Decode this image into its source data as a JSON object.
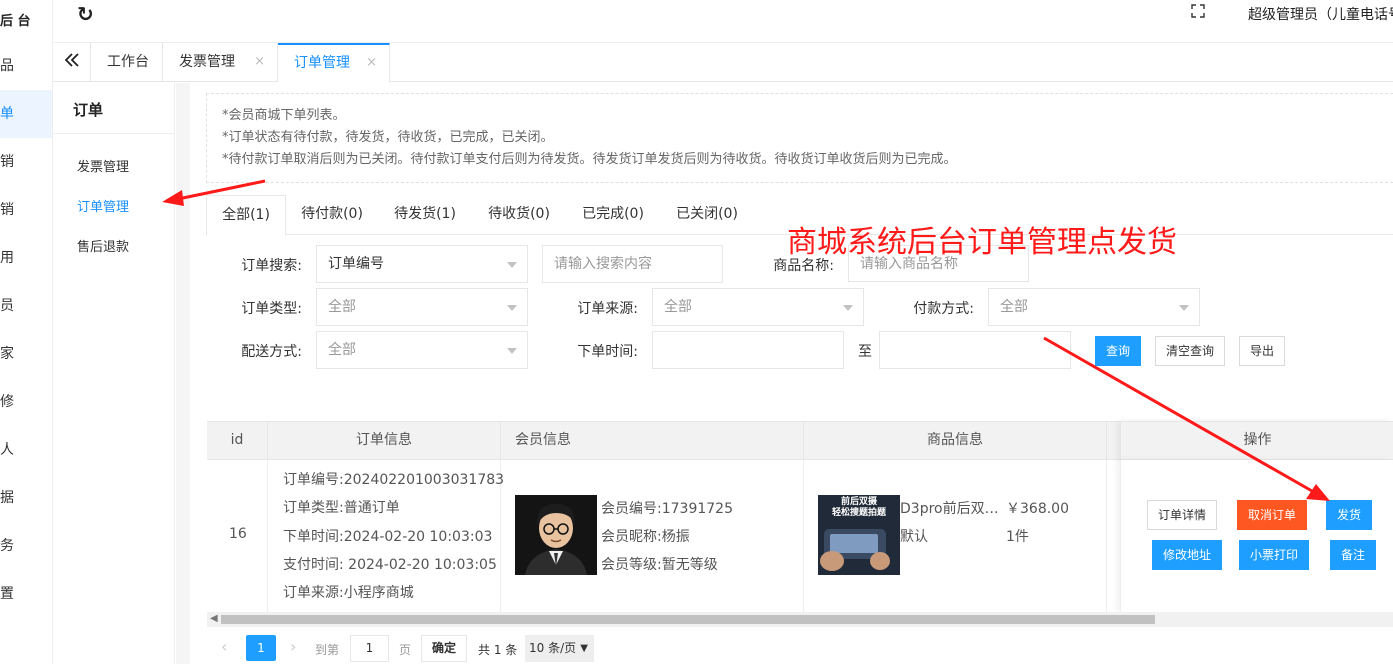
{
  "sidebar": {
    "logo": "后 台",
    "items": [
      "品",
      "单",
      "销",
      "销",
      "用",
      "员",
      "家",
      "修",
      "人",
      "据",
      "务",
      "置"
    ],
    "active_index": 1
  },
  "topbar": {
    "refresh_icon": "refresh-icon",
    "fullscreen_icon": "fullscreen-icon",
    "admin": "超级管理员（儿童电话号"
  },
  "tabs": {
    "collapse_icon": "double-chevron-left-icon",
    "items": [
      {
        "label": "工作台",
        "closable": false
      },
      {
        "label": "发票管理",
        "closable": true
      },
      {
        "label": "订单管理",
        "closable": true,
        "active": true
      }
    ],
    "close_glyph": "×"
  },
  "subnav": {
    "title": "订单",
    "items": [
      {
        "label": "发票管理"
      },
      {
        "label": "订单管理",
        "active": true
      },
      {
        "label": "售后退款"
      }
    ]
  },
  "notice": [
    "*会员商城下单列表。",
    "*订单状态有待付款，待发货，待收货，已完成，已关闭。",
    "*待付款订单取消后则为已关闭。待付款订单支付后则为待发货。待发货订单发货后则为待收货。待收货订单收货后则为已完成。"
  ],
  "status_tabs": [
    "全部(1)",
    "待付款(0)",
    "待发货(1)",
    "待收货(0)",
    "已完成(0)",
    "已关闭(0)"
  ],
  "filters": {
    "order_search_label": "订单搜索:",
    "order_search_type": "订单编号",
    "search_placeholder": "请输入搜索内容",
    "product_name_label": "商品名称:",
    "product_name_placeholder": "请输入商品名称",
    "order_type_label": "订单类型:",
    "order_type_value": "全部",
    "order_source_label": "订单来源:",
    "order_source_value": "全部",
    "pay_method_label": "付款方式:",
    "pay_method_value": "全部",
    "delivery_label": "配送方式:",
    "delivery_value": "全部",
    "order_time_label": "下单时间:",
    "to_label": "至",
    "query_button": "查询",
    "clear_button": "清空查询",
    "export_button": "导出"
  },
  "annotation": "商城系统后台订单管理点发货",
  "annotation_color": "#ff1a1a",
  "table": {
    "headers": [
      "id",
      "订单信息",
      "会员信息",
      "商品信息",
      "操作"
    ],
    "row": {
      "id": "16",
      "order_info": [
        "订单编号:202402201003031783",
        "订单类型:普通订单",
        "下单时间:2024-02-20 10:03:03",
        "支付时间: 2024-02-20 10:03:05",
        "订单来源:小程序商城"
      ],
      "member_info": [
        "会员编号:17391725",
        "会员昵称:杨振",
        "会员等级:暂无等级"
      ],
      "product": {
        "image_text": [
          "前后双摄",
          "轻松搜题拍题"
        ],
        "name": "D3pro前后双…",
        "spec": "默认",
        "price": "￥368.00",
        "qty": "1件"
      },
      "actions": {
        "detail": "订单详情",
        "cancel": "取消订单",
        "ship": "发货",
        "edit_address": "修改地址",
        "print": "小票打印",
        "remark": "备注"
      }
    }
  },
  "pagination": {
    "current_page": "1",
    "goto_label": "到第",
    "goto_value": "1",
    "page_unit": "页",
    "confirm": "确定",
    "total": "共 1 条",
    "page_size": "10 条/页"
  },
  "colors": {
    "primary": "#1e9fff",
    "danger": "#ff5722",
    "active_text": "#1890ff"
  }
}
